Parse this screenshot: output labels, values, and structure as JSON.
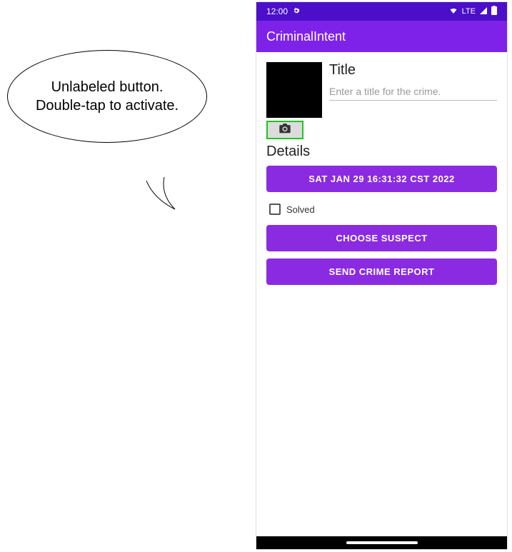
{
  "callout": {
    "line1": "Unlabeled button.",
    "line2": "Double-tap to activate."
  },
  "statusBar": {
    "time": "12:00",
    "lte": "LTE"
  },
  "appBar": {
    "title": "CriminalIntent"
  },
  "form": {
    "titleLabel": "Title",
    "titlePlaceholder": "Enter a title for the crime.",
    "titleValue": "",
    "detailsLabel": "Details",
    "dateButton": "SAT JAN 29 16:31:32 CST 2022",
    "solvedLabel": "Solved",
    "solvedChecked": false,
    "chooseSuspectButton": "CHOOSE SUSPECT",
    "sendReportButton": "SEND CRIME REPORT"
  }
}
